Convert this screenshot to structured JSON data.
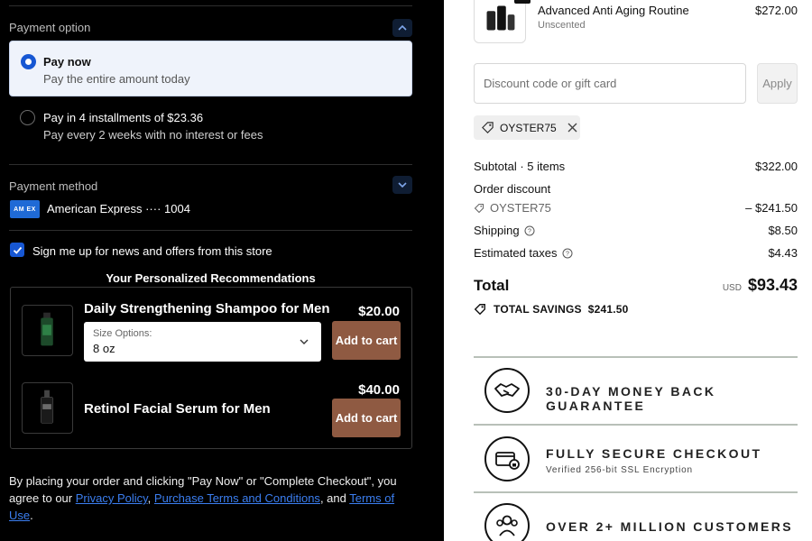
{
  "payment_option": {
    "label": "Payment option",
    "options": [
      {
        "title": "Pay now",
        "subtitle": "Pay the entire amount today",
        "selected": true
      },
      {
        "title": "Pay in 4 installments of $23.36",
        "subtitle": "Pay every 2 weeks with no interest or fees",
        "selected": false
      }
    ]
  },
  "payment_method": {
    "label": "Payment method",
    "card_brand": "AM EX",
    "card_text": "American Express ···· 1004"
  },
  "newsletter": {
    "label": "Sign me up for news and offers from this store",
    "checked": true
  },
  "recommendations": {
    "title": "Your Personalized Recommendations",
    "items": [
      {
        "name": "Daily Strengthening Shampoo for Men",
        "price": "$20.00",
        "option_label": "Size Options:",
        "option_value": "8 oz",
        "button": "Add to cart"
      },
      {
        "name": "Retinol Facial Serum for Men",
        "price": "$40.00",
        "button": "Add to cart"
      }
    ]
  },
  "terms": {
    "prefix": "By placing your order and clicking \"Pay Now\" or \"Complete Checkout\", you agree to our ",
    "privacy": "Privacy Policy",
    "sep1": ", ",
    "purchase": "Purchase Terms and Conditions",
    "sep2": ", and ",
    "use": "Terms of Use",
    "suffix": "."
  },
  "order": {
    "item_name": "Advanced Anti Aging Routine",
    "item_variant": "Unscented",
    "item_price": "$272.00"
  },
  "discount": {
    "placeholder": "Discount code or gift card",
    "apply_label": "Apply",
    "code": "OYSTER75"
  },
  "summary": {
    "subtotal_label": "Subtotal · 5 items",
    "subtotal_value": "$322.00",
    "order_discount_label": "Order discount",
    "discount_code": "OYSTER75",
    "discount_value": "– $241.50",
    "shipping_label": "Shipping",
    "shipping_value": "$8.50",
    "taxes_label": "Estimated taxes",
    "taxes_value": "$4.43",
    "total_label": "Total",
    "currency": "USD",
    "total_value": "$93.43",
    "savings_label": "TOTAL SAVINGS",
    "savings_value": "$241.50"
  },
  "guarantees": [
    {
      "title": "30-DAY MONEY BACK GUARANTEE",
      "icon": "handshake-icon"
    },
    {
      "title": "FULLY SECURE CHECKOUT",
      "subtitle": "Verified 256-bit SSL Encryption",
      "icon": "secure-card-icon"
    },
    {
      "title": "OVER 2+ MILLION CUSTOMERS",
      "icon": "customers-icon"
    }
  ],
  "colors": {
    "accent_blue": "#1757d3",
    "cart_button": "#8f5a42",
    "link": "#3b7ef0"
  }
}
